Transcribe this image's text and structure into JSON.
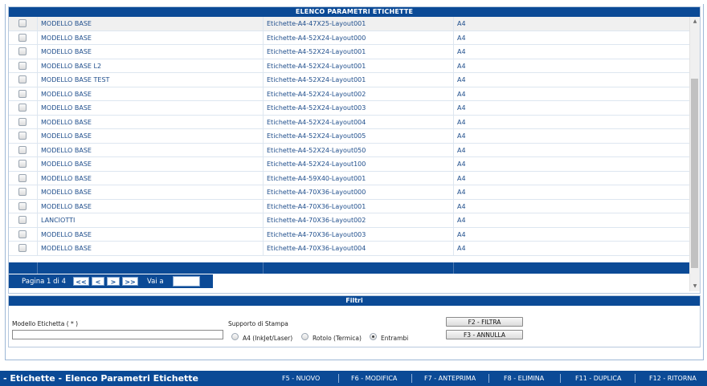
{
  "list": {
    "title": "ELENCO PARAMETRI ETICHETTE",
    "rows": [
      {
        "model": "MODELLO BASE",
        "layout": "Etichette-A4-47X25-Layout001",
        "support": "A4"
      },
      {
        "model": "MODELLO BASE",
        "layout": "Etichette-A4-52X24-Layout000",
        "support": "A4"
      },
      {
        "model": "MODELLO BASE",
        "layout": "Etichette-A4-52X24-Layout001",
        "support": "A4"
      },
      {
        "model": "MODELLO BASE L2",
        "layout": "Etichette-A4-52X24-Layout001",
        "support": "A4"
      },
      {
        "model": "MODELLO BASE TEST",
        "layout": "Etichette-A4-52X24-Layout001",
        "support": "A4"
      },
      {
        "model": "MODELLO BASE",
        "layout": "Etichette-A4-52X24-Layout002",
        "support": "A4"
      },
      {
        "model": "MODELLO BASE",
        "layout": "Etichette-A4-52X24-Layout003",
        "support": "A4"
      },
      {
        "model": "MODELLO BASE",
        "layout": "Etichette-A4-52X24-Layout004",
        "support": "A4"
      },
      {
        "model": "MODELLO BASE",
        "layout": "Etichette-A4-52X24-Layout005",
        "support": "A4"
      },
      {
        "model": "MODELLO BASE",
        "layout": "Etichette-A4-52X24-Layout050",
        "support": "A4"
      },
      {
        "model": "MODELLO BASE",
        "layout": "Etichette-A4-52X24-Layout100",
        "support": "A4"
      },
      {
        "model": "MODELLO BASE",
        "layout": "Etichette-A4-59X40-Layout001",
        "support": "A4"
      },
      {
        "model": "MODELLO BASE",
        "layout": "Etichette-A4-70X36-Layout000",
        "support": "A4"
      },
      {
        "model": "MODELLO BASE",
        "layout": "Etichette-A4-70X36-Layout001",
        "support": "A4"
      },
      {
        "model": "LANCIOTTI",
        "layout": "Etichette-A4-70X36-Layout002",
        "support": "A4"
      },
      {
        "model": "MODELLO BASE",
        "layout": "Etichette-A4-70X36-Layout003",
        "support": "A4"
      },
      {
        "model": "MODELLO BASE",
        "layout": "Etichette-A4-70X36-Layout004",
        "support": "A4"
      }
    ]
  },
  "pager": {
    "info": "Pagina 1 di 4",
    "first": "<<",
    "prev": "<",
    "next": ">",
    "last": ">>",
    "goto_label": "Vai a",
    "goto_value": ""
  },
  "filters": {
    "title": "Filtri",
    "model_label": "Modello Etichetta ( * )",
    "model_value": "",
    "support_label": "Supporto di Stampa",
    "options": [
      {
        "label": "A4 (InkJet/Laser)",
        "selected": false
      },
      {
        "label": "Rotolo (Termica)",
        "selected": false
      },
      {
        "label": "Entrambi",
        "selected": true
      }
    ],
    "filter_button": "F2 - FILTRA",
    "cancel_button": "F3 - ANNULLA"
  },
  "footer": {
    "title": "- Etichette - Elenco Parametri Etichette",
    "actions": [
      "F5 - NUOVO",
      "F6 - MODIFICA",
      "F7 - ANTEPRIMA",
      "F8 - ELIMINA",
      "F11 - DUPLICA",
      "F12 - RITORNA"
    ]
  },
  "colors": {
    "accent": "#0b4a96",
    "link_text": "#1f4e8c"
  }
}
